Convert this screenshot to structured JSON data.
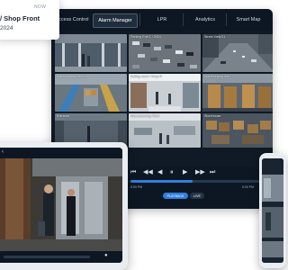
{
  "card": {
    "badge": "NOW",
    "title": "/ Shop Front",
    "date": "2024"
  },
  "nav": {
    "tabs": [
      {
        "label": "Access Control",
        "active": false
      },
      {
        "label": "Alarm Manager",
        "active": true
      },
      {
        "label": "LPR",
        "active": false
      },
      {
        "label": "Analytics",
        "active": false
      },
      {
        "label": "Smart Map",
        "active": false
      }
    ]
  },
  "cameras": [
    {
      "label": "",
      "scene": "lobby"
    },
    {
      "label": "Parking Entr 1 / 2024",
      "scene": "parking"
    },
    {
      "label": "Street View 01",
      "scene": "street"
    },
    {
      "label": "Warehousing Dep 03",
      "scene": "warehouse"
    },
    {
      "label": "Selling room / Shop R",
      "scene": "store"
    },
    {
      "label": "Warehousing line",
      "scene": "warehouse"
    },
    {
      "label": "Entrance",
      "scene": "lobby"
    },
    {
      "label": "Manufacturing Plant",
      "scene": "plant"
    },
    {
      "label": "Storehouse",
      "scene": "storehouse"
    }
  ],
  "controls": {
    "buttons": [
      "⏮",
      "◀◀",
      "◀",
      "⏸",
      "▶",
      "▶▶",
      "⏭"
    ],
    "time_left": "8:59 PM",
    "time_right": "9:00 PM",
    "pill_main": "PLAYBACK",
    "pill_secondary": "LIVE"
  },
  "colors": {
    "accent": "#2f7fe0",
    "nav_bg": "#0d1723",
    "panel_bg": "#0f1a26"
  }
}
